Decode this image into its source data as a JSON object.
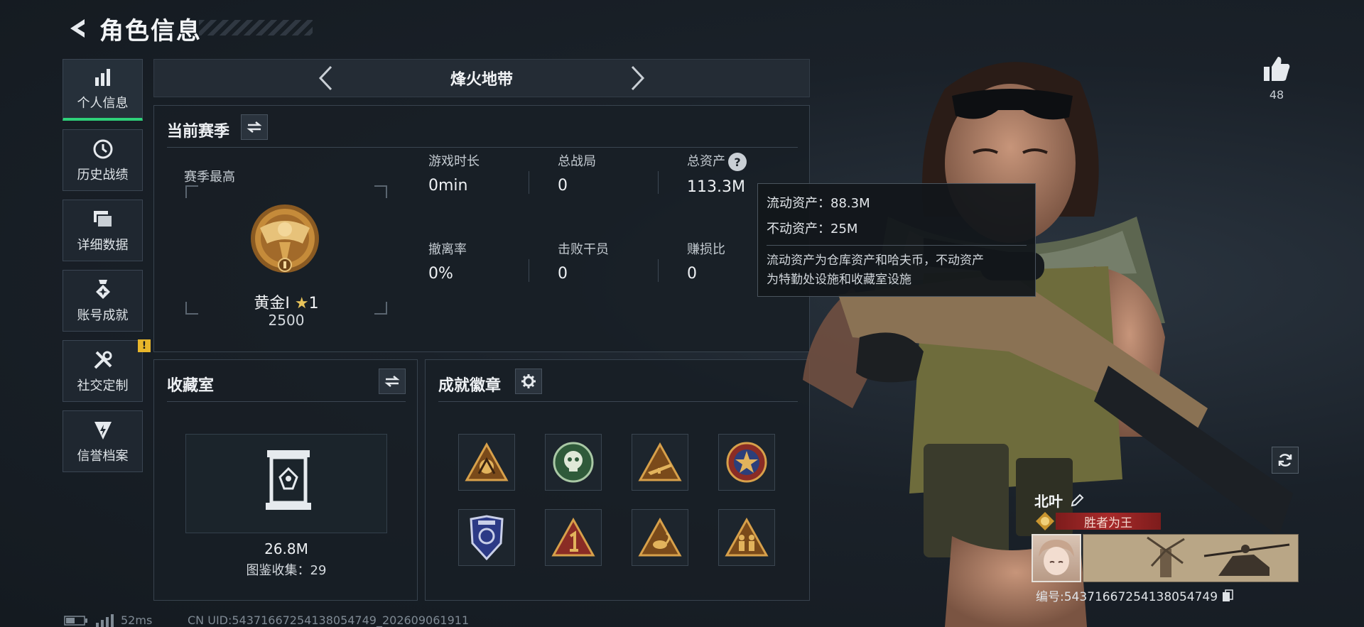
{
  "header": {
    "title": "角色信息"
  },
  "nav": {
    "items": [
      {
        "label": "个人信息",
        "icon": "bar-chart-icon",
        "active": true
      },
      {
        "label": "历史战绩",
        "icon": "history-clock-icon"
      },
      {
        "label": "详细数据",
        "icon": "folder-stack-icon"
      },
      {
        "label": "账号成就",
        "icon": "medal-star-icon"
      },
      {
        "label": "社交定制",
        "icon": "tools-wrench-icon",
        "badge": "!"
      },
      {
        "label": "信誉档案",
        "icon": "shield-lightning-icon"
      }
    ]
  },
  "mode": {
    "name": "烽火地带"
  },
  "season": {
    "title": "当前赛季",
    "rank_label": "赛季最高",
    "rank_name": "黄金Ⅰ",
    "rank_stars": "1",
    "rank_points": "2500",
    "stats": [
      {
        "label": "游戏时长",
        "value": "0min"
      },
      {
        "label": "总战局",
        "value": "0"
      },
      {
        "label": "总资产",
        "value": "113.3M",
        "help": "?"
      },
      {
        "label": "撤离率",
        "value": "0%"
      },
      {
        "label": "击败干员",
        "value": "0"
      },
      {
        "label": "赚损比",
        "value": "0"
      }
    ]
  },
  "tooltip": {
    "liquid": "流动资产：88.3M",
    "fixed": "不动资产：25M",
    "desc_line1": "流动资产为仓库资产和哈夫币，不动资产",
    "desc_line2": "为特勤处设施和收藏室设施"
  },
  "collection": {
    "title": "收藏室",
    "value": "26.8M",
    "count": "图鉴收集：29"
  },
  "badges": {
    "title": "成就徽章",
    "items": [
      {
        "name": "badge-gold-triangle-icon",
        "color": "#c98a2e"
      },
      {
        "name": "badge-green-skull-icon",
        "color": "#4c8a57"
      },
      {
        "name": "badge-rifle-triangle-icon",
        "color": "#c98a2e"
      },
      {
        "name": "badge-star-medal-icon",
        "color": "#b8453a"
      },
      {
        "name": "badge-blue-shield-icon",
        "color": "#3a4aa0"
      },
      {
        "name": "badge-number-one-icon",
        "color": "#b8453a"
      },
      {
        "name": "badge-scorpion-triangle-icon",
        "color": "#c98a2e"
      },
      {
        "name": "badge-soldiers-triangle-icon",
        "color": "#c98a2e"
      }
    ]
  },
  "like": {
    "count": "48"
  },
  "player": {
    "name": "北叶",
    "title": "胜者为王",
    "id": "编号:54371667254138054749"
  },
  "footer": {
    "ping": "52ms",
    "uid": "CN UID:54371667254138054749_202609061911"
  },
  "colors": {
    "accent": "#2fd17a",
    "warning": "#e8b62b",
    "ribbon": "#a82a2a"
  }
}
